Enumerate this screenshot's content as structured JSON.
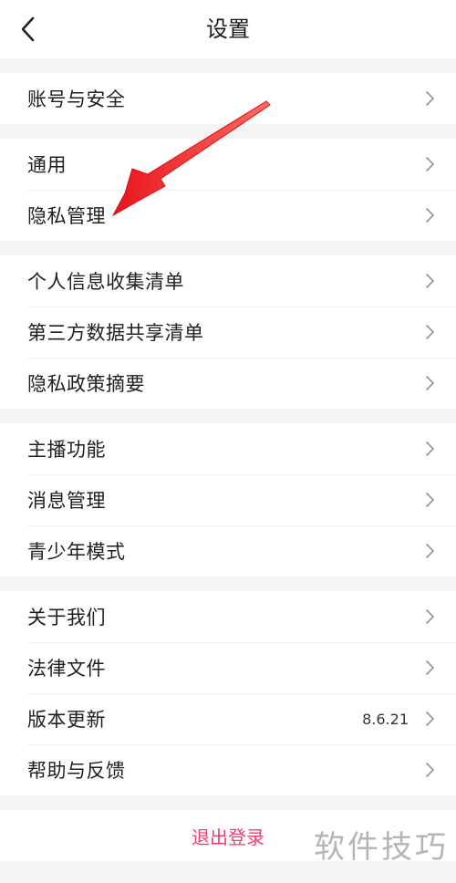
{
  "header": {
    "title": "设置",
    "back_icon": "chevron-left-icon"
  },
  "groups": [
    {
      "items": [
        {
          "label": "账号与安全"
        }
      ]
    },
    {
      "items": [
        {
          "label": "通用"
        },
        {
          "label": "隐私管理"
        }
      ]
    },
    {
      "items": [
        {
          "label": "个人信息收集清单"
        },
        {
          "label": "第三方数据共享清单"
        },
        {
          "label": "隐私政策摘要"
        }
      ]
    },
    {
      "items": [
        {
          "label": "主播功能"
        },
        {
          "label": "消息管理"
        },
        {
          "label": "青少年模式"
        }
      ]
    },
    {
      "items": [
        {
          "label": "关于我们"
        },
        {
          "label": "法律文件"
        },
        {
          "label": "版本更新",
          "value": "8.6.21"
        },
        {
          "label": "帮助与反馈"
        }
      ]
    }
  ],
  "logout": {
    "label": "退出登录"
  },
  "watermark": "软件技巧",
  "colors": {
    "accent": "#ef3f6a",
    "annotation_arrow": "#e8141c",
    "background": "#f4f4f6"
  }
}
